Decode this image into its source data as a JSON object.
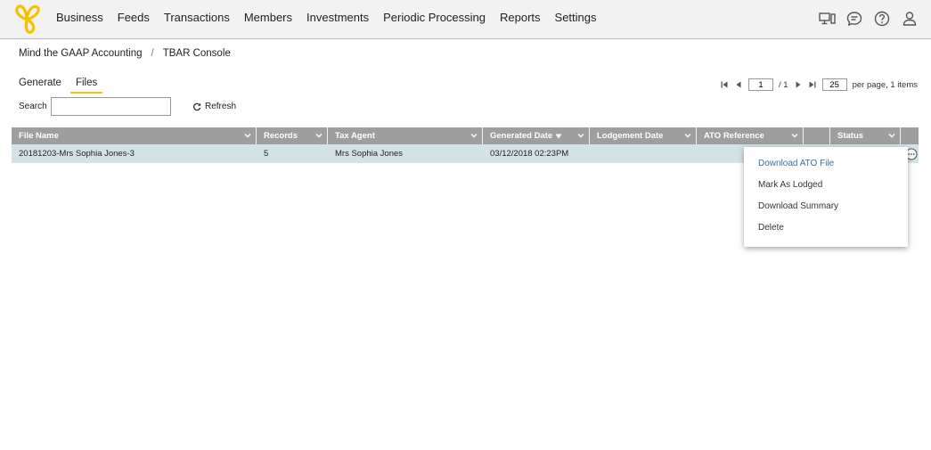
{
  "nav": {
    "items": [
      "Business",
      "Feeds",
      "Transactions",
      "Members",
      "Investments",
      "Periodic Processing",
      "Reports",
      "Settings"
    ]
  },
  "top_icons": [
    "monitor-icon",
    "chat-icon",
    "help-icon",
    "user-icon"
  ],
  "breadcrumb": {
    "parent": "Mind the GAAP Accounting",
    "separator": "/",
    "current": "TBAR Console"
  },
  "tabs": [
    "Generate",
    "Files"
  ],
  "active_tab": "Files",
  "pager": {
    "page": "1",
    "of_pages": "/ 1",
    "per_page": "25",
    "per_page_label": "per page, 1 items"
  },
  "search": {
    "label": "Search",
    "value": ""
  },
  "refresh_label": "Refresh",
  "grid": {
    "columns": [
      "File Name",
      "Records",
      "Tax Agent",
      "Generated Date",
      "Lodgement Date",
      "ATO Reference",
      "",
      "Status"
    ],
    "sorted_column": "Generated Date",
    "sort_direction": "descending",
    "rows": [
      {
        "file_name": "20181203-Mrs Sophia Jones-3",
        "records": "5",
        "tax_agent": "Mrs Sophia Jones",
        "generated_date": "03/12/2018 02:23PM",
        "lodgement_date": "",
        "ato_reference": "",
        "status": ""
      }
    ]
  },
  "context_menu": {
    "items": [
      "Download ATO File",
      "Mark As Lodged",
      "Download Summary",
      "Delete"
    ]
  },
  "colors": {
    "accent": "#f5c200",
    "grid_header": "#9e9e9e",
    "selected_row": "#d3e2e6",
    "menu_highlight": "#3f6fa0"
  }
}
